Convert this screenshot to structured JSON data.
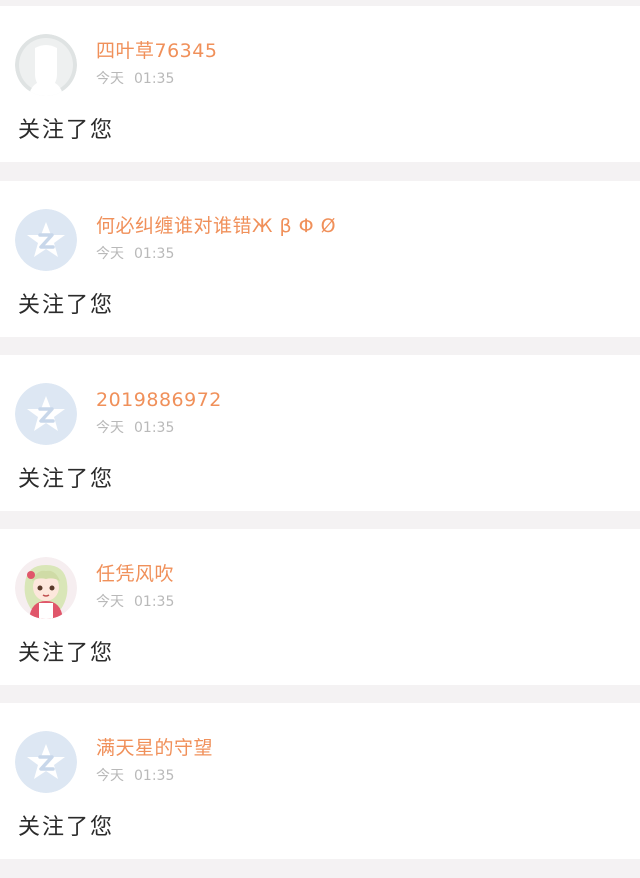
{
  "theme": {
    "accent": "#f0905a",
    "meta_color": "#b9b9b9",
    "separator": "#f4f2f3"
  },
  "notifications": [
    {
      "avatar_icon": "person-silhouette-icon",
      "username": "四叶草76345",
      "date_label": "今天",
      "time": "01:35",
      "message": "关注了您"
    },
    {
      "avatar_icon": "qq-logo-icon",
      "username": "何必纠缠谁对谁错Ж β Φ Ø",
      "date_label": "今天",
      "time": "01:35",
      "message": "关注了您"
    },
    {
      "avatar_icon": "qq-logo-icon",
      "username": "2019886972",
      "date_label": "今天",
      "time": "01:35",
      "message": "关注了您"
    },
    {
      "avatar_icon": "anime-character-icon",
      "username": "任凭风吹",
      "date_label": "今天",
      "time": "01:35",
      "message": "关注了您"
    },
    {
      "avatar_icon": "qq-logo-icon",
      "username": "满天星的守望",
      "date_label": "今天",
      "time": "01:35",
      "message": "关注了您"
    }
  ]
}
